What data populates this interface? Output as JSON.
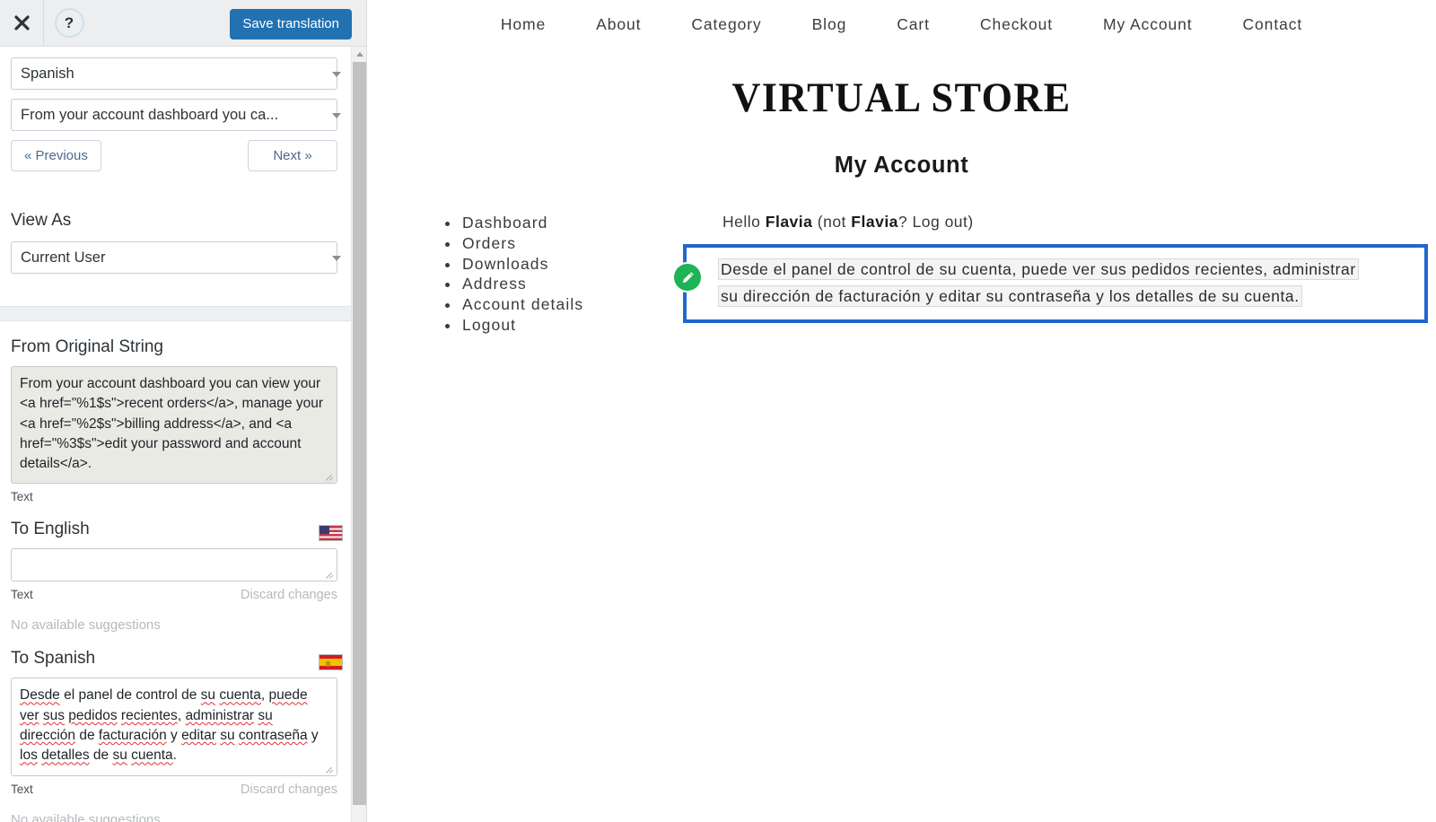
{
  "editor": {
    "header": {
      "close_icon": "close-icon",
      "help_icon": "help-question-icon",
      "help_label": "?",
      "save_label": "Save translation",
      "save_color": "#2271b1"
    },
    "language_select": {
      "value": "Spanish",
      "icon": "chevron-down-icon"
    },
    "string_select": {
      "value": "From your account dashboard you ca...",
      "icon": "chevron-down-icon"
    },
    "pagination": {
      "previous_label": "« Previous",
      "next_label": "Next »"
    },
    "view_as": {
      "label": "View As",
      "value": "Current User",
      "icon": "chevron-down-icon"
    },
    "original": {
      "title": "From Original String",
      "value": "From your account dashboard you can view your <a href=\"%1$s\">recent orders</a>, manage your <a href=\"%2$s\">billing address</a>, and <a href=\"%3$s\">edit your password and account details</a>.",
      "type_label": "Text"
    },
    "to_english": {
      "title": "To English",
      "flag": "flag-us-icon",
      "value": "",
      "type_label": "Text",
      "discard_label": "Discard changes",
      "suggestions_label": "No available suggestions"
    },
    "to_spanish": {
      "title": "To Spanish",
      "flag": "flag-es-icon",
      "value": "Desde el panel de control de su cuenta, puede ver sus pedidos recientes, administrar su dirección de facturación y editar su contraseña y los detalles de su cuenta.",
      "type_label": "Text",
      "discard_label": "Discard changes",
      "suggestions_label": "No available suggestions"
    }
  },
  "preview": {
    "nav": [
      {
        "label": "Home"
      },
      {
        "label": "About"
      },
      {
        "label": "Category"
      },
      {
        "label": "Blog"
      },
      {
        "label": "Cart"
      },
      {
        "label": "Checkout"
      },
      {
        "label": "My Account"
      },
      {
        "label": "Contact"
      }
    ],
    "brand": "VIRTUAL STORE",
    "page_title": "My Account",
    "account_menu": [
      {
        "label": "Dashboard"
      },
      {
        "label": "Orders"
      },
      {
        "label": "Downloads"
      },
      {
        "label": "Address"
      },
      {
        "label": "Account details"
      },
      {
        "label": "Logout"
      }
    ],
    "greeting": {
      "hello": "Hello",
      "user_name": "Flavia",
      "not_prefix": "(not",
      "user_name_2": "Flavia",
      "logout_suffix": "? Log out)"
    },
    "translated_block": {
      "pencil_icon": "pencil-edit-icon",
      "line_1": "Desde el panel de control de su cuenta, puede ver sus pedidos recientes, administrar",
      "line_2": "su dirección de facturación y editar su contraseña y los detalles de su cuenta.",
      "highlight_border_color": "#1f68cc",
      "pencil_badge_color": "#1eb355"
    }
  }
}
